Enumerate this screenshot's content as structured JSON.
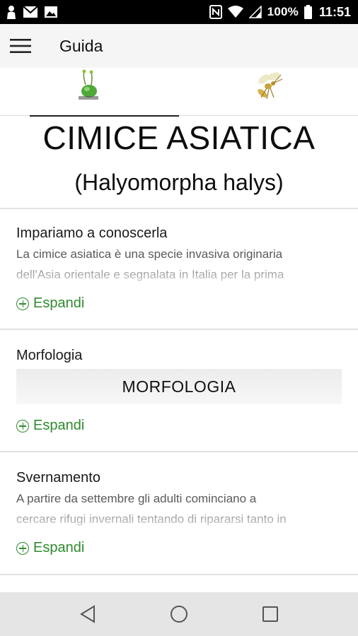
{
  "status_bar": {
    "battery_percent": "100%",
    "time": "11:51",
    "icons": [
      "person-icon",
      "mail-icon",
      "image-icon",
      "nfc-icon",
      "wifi-icon",
      "signal-icon",
      "battery-icon"
    ]
  },
  "app_bar": {
    "title": "Guida",
    "menu_icon": "hamburger-menu-icon"
  },
  "tabs": [
    {
      "icon": "stink-bug-icon",
      "active": true
    },
    {
      "icon": "wasp-icon",
      "active": false
    }
  ],
  "header": {
    "title": "CIMICE ASIATICA",
    "subtitle": "(Halyomorpha halys)"
  },
  "sections": [
    {
      "title": "Impariamo a conoscerla",
      "text_line1": "La cimice asiatica è una specie invasiva originaria",
      "text_line2": "dell'Asia orientale e segnalata in Italia per la prima",
      "expand_label": "Espandi"
    },
    {
      "title": "Morfologia",
      "box_label": "MORFOLOGIA",
      "expand_label": "Espandi"
    },
    {
      "title": "Svernamento",
      "text_line1": "A partire da settembre gli adulti cominciano a",
      "text_line2": "cercare rifugi invernali tentando di ripararsi tanto in",
      "expand_label": "Espandi"
    }
  ],
  "colors": {
    "accent_green": "#2e8b2e",
    "app_bar_bg": "#f5f5f5",
    "status_bar_bg": "#000000",
    "nav_bar_bg": "#e5e5e5"
  },
  "nav_bar": {
    "buttons": [
      "back-icon",
      "home-icon",
      "recents-icon"
    ]
  }
}
